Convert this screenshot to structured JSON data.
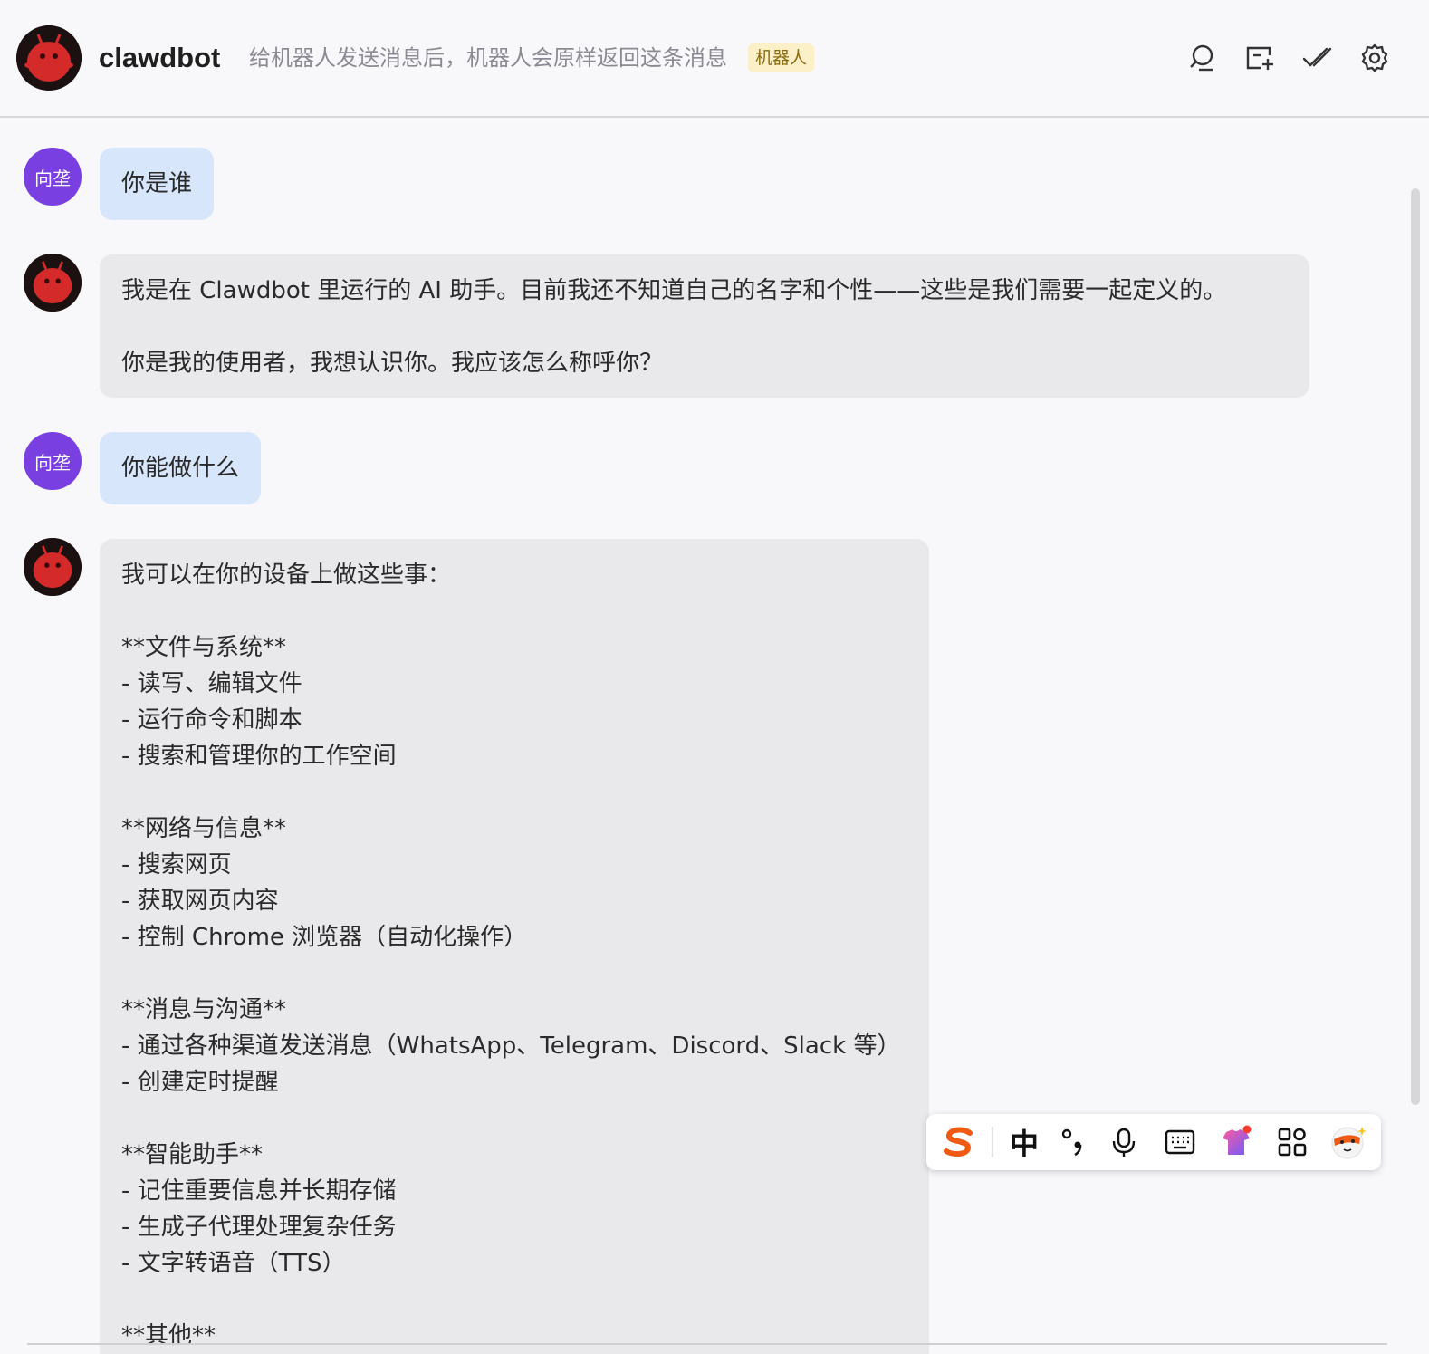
{
  "header": {
    "title": "clawdbot",
    "description": "给机器人发送消息后，机器人会原样返回这条消息",
    "badge": "机器人",
    "icons": [
      "search-icon",
      "new-chat-icon",
      "mark-read-icon",
      "settings-icon"
    ]
  },
  "user": {
    "avatar_text": "向垄",
    "avatar_color": "#7a3fe0"
  },
  "colors": {
    "user_bubble": "#d8e6fb",
    "bot_bubble": "#e9e9ec",
    "bot_avatar": "#d42a2a",
    "badge_bg": "#fbf0c8"
  },
  "messages": [
    {
      "role": "user",
      "text": "你是谁"
    },
    {
      "role": "bot",
      "text": "我是在 Clawdbot 里运行的 AI 助手。目前我还不知道自己的名字和个性——这些是我们需要一起定义的。\n\n你是我的使用者，我想认识你。我应该怎么称呼你？"
    },
    {
      "role": "user",
      "text": "你能做什么"
    },
    {
      "role": "bot",
      "text": "我可以在你的设备上做这些事：\n\n**文件与系统**\n- 读写、编辑文件\n- 运行命令和脚本\n- 搜索和管理你的工作空间\n\n**网络与信息**\n- 搜索网页\n- 获取网页内容\n- 控制 Chrome 浏览器（自动化操作）\n\n**消息与沟通**\n- 通过各种渠道发送消息（WhatsApp、Telegram、Discord、Slack 等）\n- 创建定时提醒\n\n**智能助手**\n- 记住重要信息并长期存储\n- 生成子代理处理复杂任务\n- 文字转语音（TTS）\n\n**其他**"
    }
  ],
  "ime_toolbar": {
    "mode_label": "中",
    "icons": [
      "sogou-logo-icon",
      "punctuation-icon",
      "microphone-icon",
      "keyboard-icon",
      "skin-icon",
      "apps-grid-icon",
      "mascot-icon"
    ]
  }
}
